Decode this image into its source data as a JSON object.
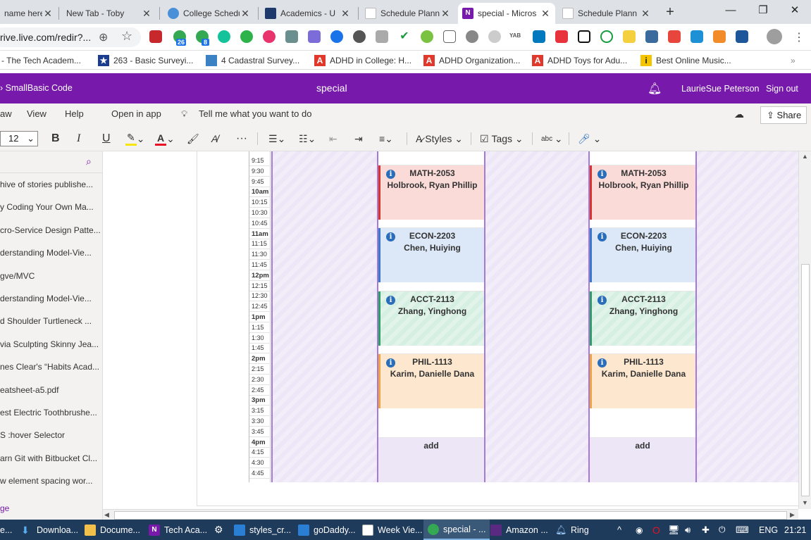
{
  "browser": {
    "tabs": [
      {
        "title": "name here"
      },
      {
        "title": "New Tab - Toby"
      },
      {
        "title": "College Schedu"
      },
      {
        "title": "Academics - U"
      },
      {
        "title": "Schedule Plann"
      },
      {
        "title": "special - Micros"
      },
      {
        "title": "Schedule Plann"
      }
    ],
    "active_tab_index": 5,
    "new_tab": "+",
    "window": {
      "minimize": "—",
      "maximize": "❐",
      "close": "✕"
    },
    "address": "rive.live.com/redir?...",
    "ext_badges": {
      "calendar": "26",
      "chat": "8",
      "yab": "YAB"
    },
    "bookmarks": [
      {
        "label": "- The Tech Academ..."
      },
      {
        "label": "263 - Basic Surveyi..."
      },
      {
        "label": "4 Cadastral Survey..."
      },
      {
        "label": "ADHD in College: H..."
      },
      {
        "label": "ADHD Organization..."
      },
      {
        "label": "ADHD Toys for Adu..."
      },
      {
        "label": "Best Online Music..."
      }
    ],
    "bookmarks_more": "»"
  },
  "onenote": {
    "breadcrumb": "SmallBasic Code",
    "title": "special",
    "user": "LaurieSue Peterson",
    "signout": "Sign out",
    "menus": {
      "view_partial": "aw",
      "view": "View",
      "help": "Help",
      "open_in_app": "Open in app",
      "tell_me": "Tell me what you want to do",
      "share": "Share"
    },
    "ribbon": {
      "font_size": "12",
      "bold": "B",
      "italic": "I",
      "underline": "U",
      "more": "···",
      "styles": "Styles",
      "tags": "Tags",
      "spell": "abc"
    },
    "pages": [
      "hive of stories publishe...",
      "y Coding Your Own Ma...",
      "cro-Service Design Patte...",
      "derstanding Model-Vie...",
      "gve/MVC",
      "derstanding Model-Vie...",
      "d Shoulder Turtleneck ...",
      "via Sculpting Skinny Jea...",
      "nes Clear's “Habits Acad...",
      "eatsheet-a5.pdf",
      "est Electric Toothbrushe...",
      "S :hover Selector",
      "arn Git with Bitbucket Cl...",
      "w element spacing wor..."
    ],
    "add_page": "ge"
  },
  "schedule": {
    "times": [
      "9:15",
      "9:30",
      "9:45",
      "10am",
      "10:15",
      "10:30",
      "10:45",
      "11am",
      "11:15",
      "11:30",
      "11:45",
      "12pm",
      "12:15",
      "12:30",
      "12:45",
      "1pm",
      "1:15",
      "1:30",
      "1:45",
      "2pm",
      "2:15",
      "2:30",
      "2:45",
      "3pm",
      "3:15",
      "3:30",
      "3:45",
      "4pm",
      "4:15",
      "4:30",
      "4:45"
    ],
    "day_a": {
      "courses": [
        {
          "code": "MATH-2053",
          "instructor": "Holbrook, Ryan Phillip"
        },
        {
          "code": "ECON-2203",
          "instructor": "Chen, Huiying"
        },
        {
          "code": "ACCT-2113",
          "instructor": "Zhang, Yinghong"
        },
        {
          "code": "PHIL-1113",
          "instructor": "Karim, Danielle Dana"
        }
      ],
      "add": "add"
    },
    "day_b": {
      "courses": [
        {
          "code": "MATH-2053",
          "instructor": "Holbrook, Ryan Phillip"
        },
        {
          "code": "ECON-2203",
          "instructor": "Chen, Huiying"
        },
        {
          "code": "ACCT-2113",
          "instructor": "Zhang, Yinghong"
        },
        {
          "code": "PHIL-1113",
          "instructor": "Karim, Danielle Dana"
        }
      ],
      "add": "add"
    },
    "colors": {
      "math_bg": "#fadbd8",
      "math_bar": "#d9342b",
      "econ_bg": "#dce7f7",
      "econ_bar": "#3a78c9",
      "acct_bg": "#d6efe3",
      "acct_bar": "#2f9e63",
      "phil_bg": "#fde7cf",
      "phil_bar": "#f0a341"
    }
  },
  "taskbar": {
    "items": [
      {
        "label": "e..."
      },
      {
        "label": "Downloa..."
      },
      {
        "label": "Docume..."
      },
      {
        "label": "Tech Aca..."
      },
      {
        "label": "styles_cr..."
      },
      {
        "label": "goDaddy..."
      },
      {
        "label": "Week Vie..."
      },
      {
        "label": "special - ..."
      },
      {
        "label": "Amazon ..."
      },
      {
        "label": "Ring"
      }
    ],
    "lang": "ENG",
    "time": "21:21",
    "chevron": "^"
  }
}
